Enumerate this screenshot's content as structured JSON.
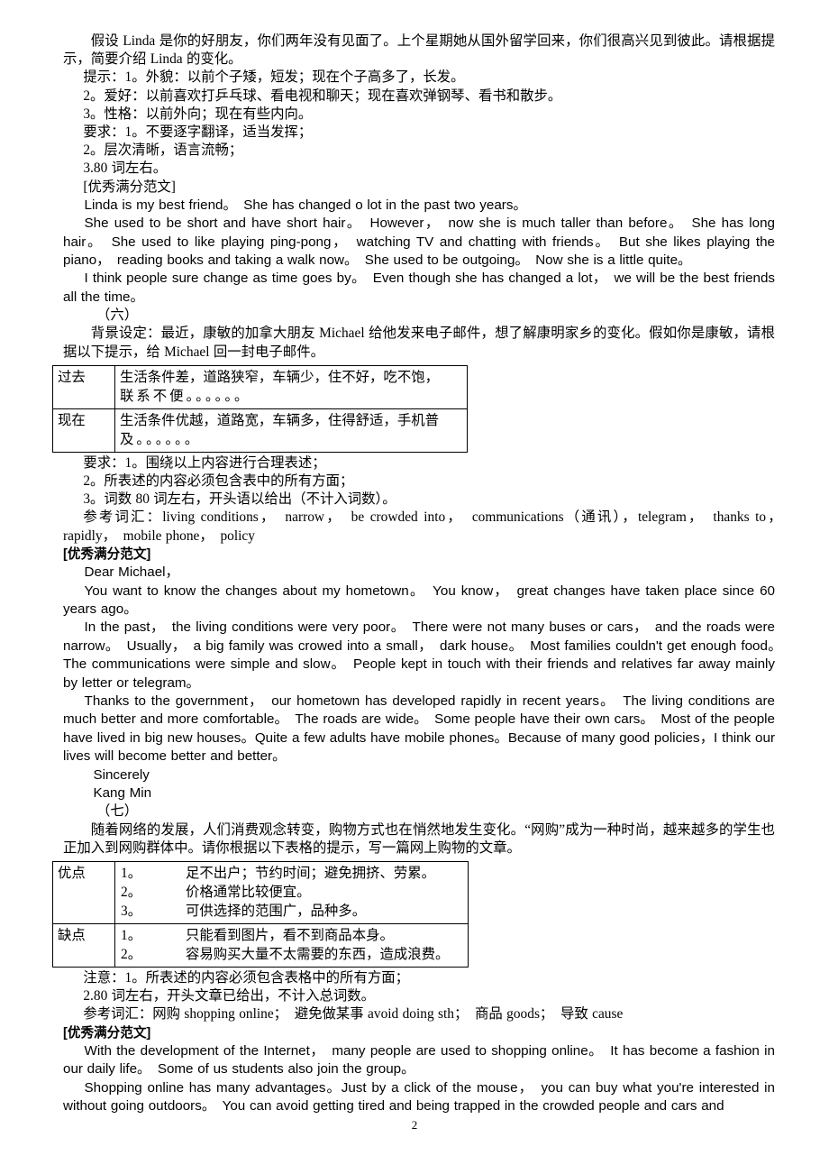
{
  "page": {
    "number": "2"
  },
  "section_five": {
    "prompt_line1": "假设 Linda 是你的好朋友，你们两年没有见面了。上个星期她从国外留学回来，你们很高兴见到彼此。请根据提示，简要介绍 Linda 的变化。",
    "hints": [
      "提示：1。外貌：以前个子矮，短发；现在个子高多了，长发。",
      "2。爱好：以前喜欢打乒乓球、看电视和聊天；现在喜欢弹钢琴、看书和散步。",
      "3。性格：以前外向；现在有些内向。"
    ],
    "requirements": [
      "要求：1。不要逐字翻译，适当发挥；",
      "2。层次清晰，语言流畅；",
      "3.80 词左右。"
    ],
    "model_label": "[优秀满分范文]",
    "essay": [
      "Linda is my best friend。　She has changed o lot in the past two years。",
      "She used to be short and have short hair。　However，　now she is much taller than before。　She has long hair。　She used to like playing ping-pong，　watching TV and chatting with friends。　But she likes playing the piano，　reading books and taking a walk now。　She used to be outgoing。　Now she is a little quite。",
      "I think people sure change as time goes by。　Even though she has changed a lot，　we will be the best friends all the time。"
    ]
  },
  "section_six": {
    "marker": "（六）",
    "background": "背景设定：最近，康敏的加拿大朋友 Michael 给他发来电子邮件，想了解康明家乡的变化。假如你是康敏，请根据以下提示，给 Michael 回一封电子邮件。",
    "table": {
      "rows": [
        {
          "key": "过去",
          "lines": [
            "生活条件差，道路狭窄，车辆少，住不好，吃不饱，",
            "联系不便。。。。。。"
          ]
        },
        {
          "key": "现在",
          "lines": [
            "生活条件优越，道路宽，车辆多，住得舒适，手机普",
            "及。。。。。。"
          ]
        }
      ]
    },
    "requirements": [
      "要求：1。围绕以上内容进行合理表述；",
      "2。所表述的内容必须包含表中的所有方面；",
      "3。词数 80 词左右，开头语以给出（不计入词数）。"
    ],
    "vocab": "参考词汇：living conditions，　narrow，　be crowded into，　communications（通讯），telegram，　thanks to，　rapidly，　mobile phone，　policy",
    "model_label": "[优秀满分范文]",
    "salutation": "Dear Michael，",
    "essay": [
      "You want to know the changes about my hometown。　You know，　great changes have taken place since 60 years ago。",
      "In the past，　the living conditions were very poor。　There were not many buses or cars，　and the roads were narrow。　Usually，　a big family was crowed into a small，　dark house。　Most families couldn't get enough food。　The communications were simple and slow。　People kept in touch with their friends and relatives far away mainly by letter or telegram。",
      "Thanks to the government，　our hometown has developed rapidly in recent years。　The living conditions are much better and more comfortable。　The roads are wide。　Some people have their own cars。　Most of the people have lived in big new houses。Quite a few adults have mobile phones。Because of many good policies，I think our lives will become better and better。"
    ],
    "closing": "Sincerely",
    "signature": "Kang Min"
  },
  "section_seven": {
    "marker": "（七）",
    "intro": "随着网络的发展，人们消费观念转变，购物方式也在悄然地发生变化。“网购”成为一种时尚，越来越多的学生也正加入到网购群体中。请你根据以下表格的提示，写一篇网上购物的文章。",
    "table": {
      "rows": [
        {
          "key": "优点",
          "items": [
            {
              "num": "1。",
              "text": "足不出户；节约时间；避免拥挤、劳累。"
            },
            {
              "num": "2。",
              "text": "价格通常比较便宜。"
            },
            {
              "num": "3。",
              "text": "可供选择的范围广，品种多。"
            }
          ]
        },
        {
          "key": "缺点",
          "items": [
            {
              "num": "1。",
              "text": "只能看到图片，看不到商品本身。"
            },
            {
              "num": "2。",
              "text": "容易购买大量不太需要的东西，造成浪费。"
            }
          ]
        }
      ]
    },
    "requirements": [
      "注意：1。所表述的内容必须包含表格中的所有方面；",
      "2.80 词左右，开头文章已给出，不计入总词数。"
    ],
    "vocab": "参考词汇：网购 shopping online；　避免做某事 avoid doing sth；　商品 goods；　导致 cause",
    "model_label": "[优秀满分范文]",
    "essay": [
      "With the development of the Internet，　many people are used to shopping online。　It has become a fashion in our daily life。　Some of us students also join the group。",
      "Shopping online has many advantages。Just by a click of the mouse，　you can buy what you're interested in without going outdoors。　You can avoid getting tired and being trapped in the crowded people and cars and"
    ]
  }
}
